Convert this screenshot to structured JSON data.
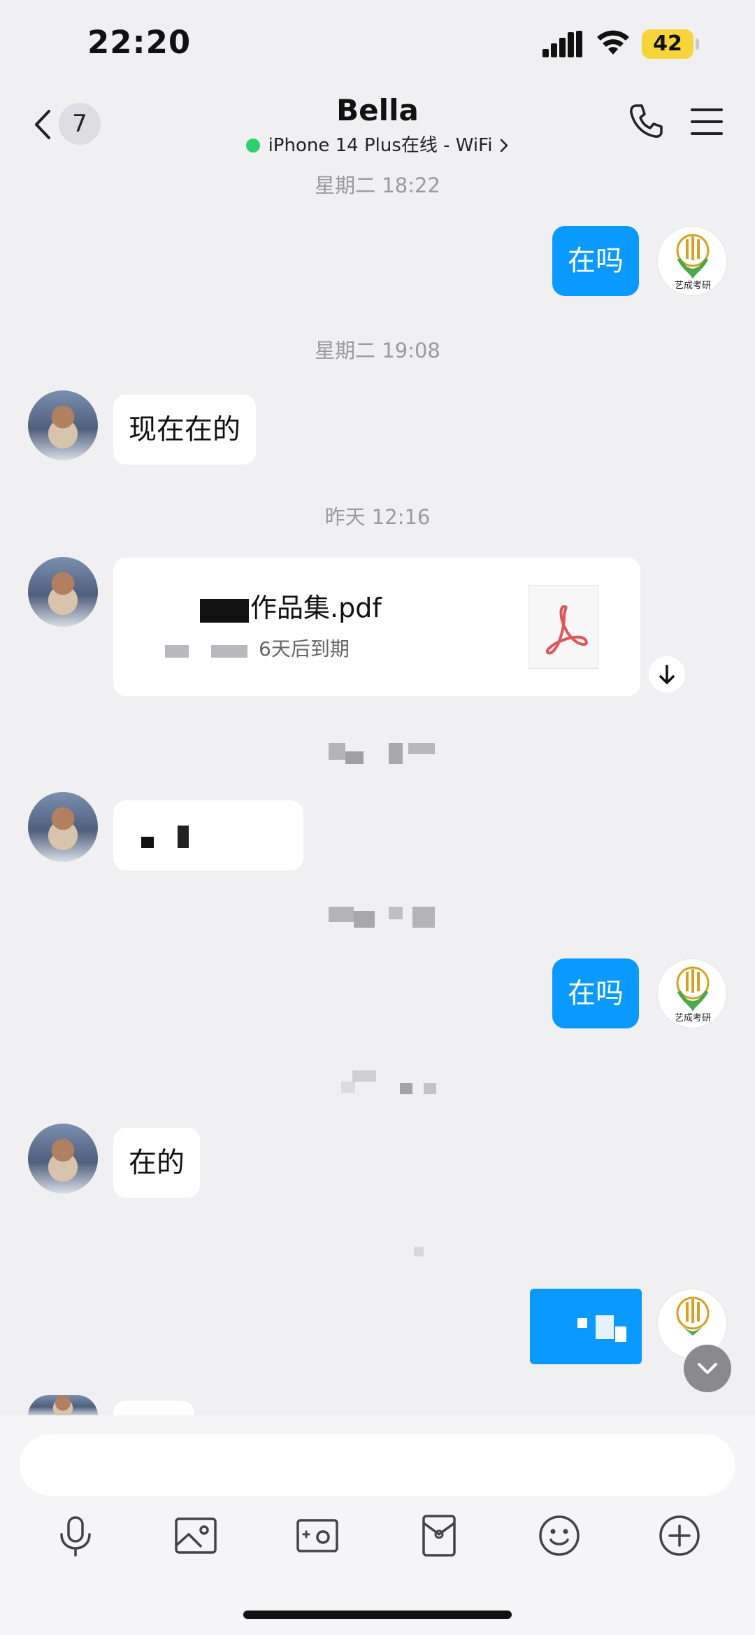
{
  "status_bar": {
    "time": "22:20",
    "battery": "42",
    "battery_color": "#f6d43a"
  },
  "header": {
    "unread_count": "7",
    "contact_name": "Bella",
    "contact_status": "iPhone 14 Plus在线 - WiFi",
    "online_color": "#2dd06e",
    "icons": [
      "back-icon",
      "phone-icon",
      "menu-icon"
    ]
  },
  "messages": {
    "ts1": "星期二 18:22",
    "out1": "在吗",
    "ts2": "星期二 19:08",
    "in1": "现在在的",
    "ts3": "昨天 12:16",
    "file": {
      "name": "作品集.pdf",
      "expiry": "6天后到期"
    },
    "out2": "在吗",
    "in3": "在的",
    "own_avatar_text": "艺成考研"
  },
  "colors": {
    "bubble_out": "#0a99ff",
    "bubble_in": "#ffffff",
    "background": "#f0f0f2"
  },
  "input": {
    "placeholder": ""
  },
  "toolbar": {
    "icons": [
      "microphone-icon",
      "image-icon",
      "camera-icon",
      "red-packet-icon",
      "emoji-icon",
      "plus-icon"
    ]
  }
}
